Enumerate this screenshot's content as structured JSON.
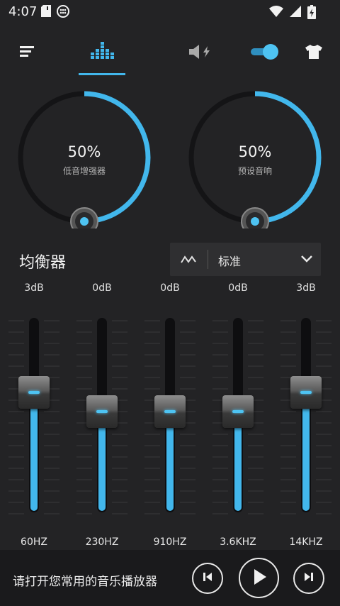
{
  "status": {
    "time": "4:07"
  },
  "toolbar": {
    "menu_icon": "menu-icon",
    "equalizer_tab_icon": "equalizer-icon",
    "speaker_icon": "speaker-boost-icon",
    "toggle_icon": "toggle-switch",
    "theme_icon": "tshirt-icon",
    "accent": "#42b7ec"
  },
  "dials": [
    {
      "percent": "50%",
      "label": "低音增强器",
      "value": 0.5
    },
    {
      "percent": "50%",
      "label": "预设音响",
      "value": 0.5
    }
  ],
  "equalizer": {
    "title": "均衡器",
    "preset": "标准",
    "bands": [
      {
        "gain": "3dB",
        "freq": "60HZ",
        "level": 0.6
      },
      {
        "gain": "0dB",
        "freq": "230HZ",
        "level": 0.5
      },
      {
        "gain": "0dB",
        "freq": "910HZ",
        "level": 0.5
      },
      {
        "gain": "0dB",
        "freq": "3.6KHZ",
        "level": 0.5
      },
      {
        "gain": "3dB",
        "freq": "14KHZ",
        "level": 0.6
      }
    ]
  },
  "player": {
    "message": "请打开您常用的音乐播放器"
  }
}
